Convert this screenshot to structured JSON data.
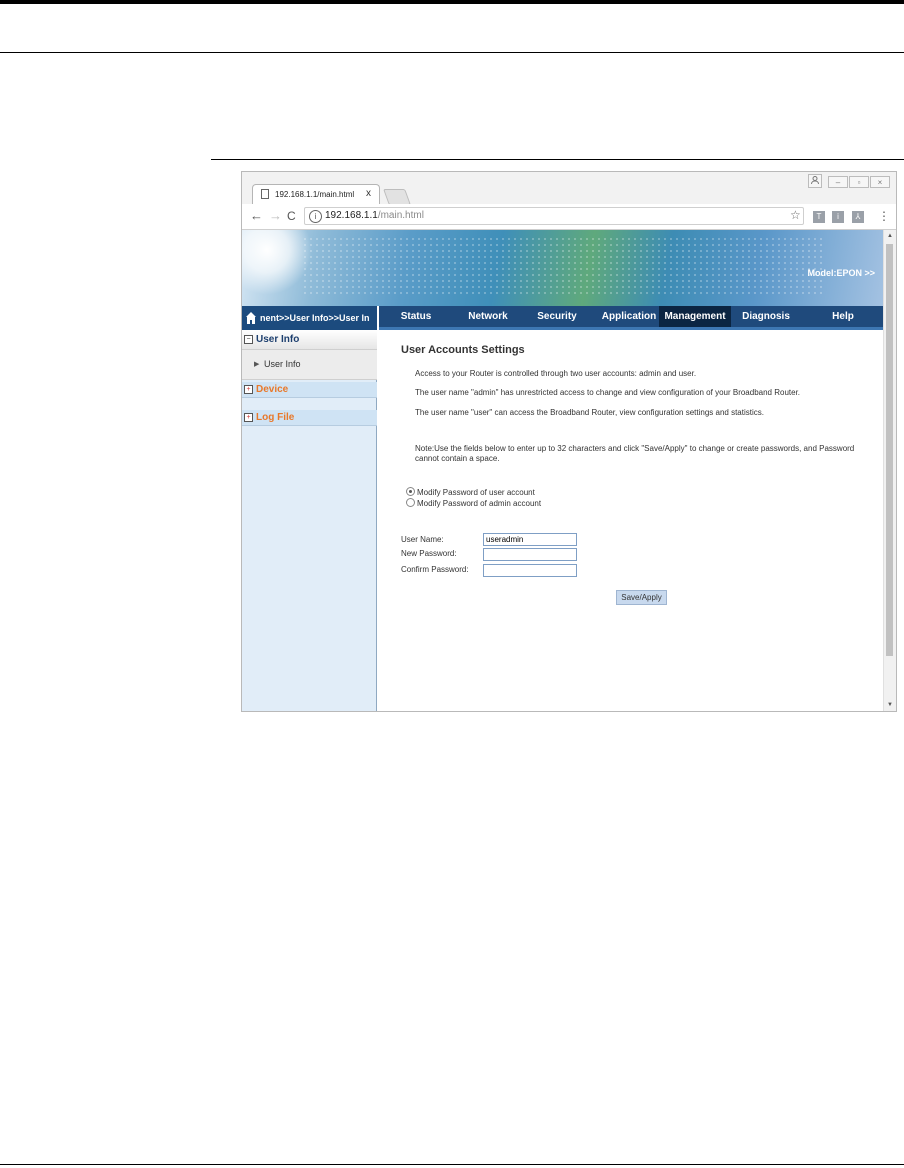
{
  "browser": {
    "tab_title": "192.168.1.1/main.html",
    "tab_close": "x",
    "url_host": "192.168.1.1",
    "url_path": "/main.html"
  },
  "banner": {
    "model": "Model:EPON  >>"
  },
  "breadcrumb": "nent>>User Info>>User In",
  "nav": {
    "items": [
      "Status",
      "Network",
      "Security",
      "Application",
      "Management",
      "Diagnosis",
      "Help"
    ],
    "active": "Management"
  },
  "sidebar": {
    "sections": [
      {
        "label": "User Info",
        "expanded": true,
        "children": [
          "User Info"
        ]
      },
      {
        "label": "Device",
        "expanded": false
      },
      {
        "label": "Log File",
        "expanded": false
      }
    ]
  },
  "page": {
    "title": "User Accounts Settings",
    "para1": "Access to your Router is controlled through two user accounts: admin and user.",
    "para2": "The user name \"admin\" has unrestricted access to change and view configuration of your Broadband Router.",
    "para3": "The user name \"user\" can access the Broadband Router, view configuration settings and statistics.",
    "note_line1": "Note:Use the fields below to enter up to 32 characters and click \"Save/Apply\" to change or create passwords, and Password",
    "note_line2": "cannot contain a space.",
    "radio_user": "Modify Password of user account",
    "radio_admin": "Modify Password of admin account",
    "selected_radio": "user",
    "user_name_label": "User Name:",
    "user_name_value": "useradmin",
    "new_password_label": "New Password:",
    "confirm_password_label": "Confirm Password:",
    "save_label": "Save/Apply"
  }
}
